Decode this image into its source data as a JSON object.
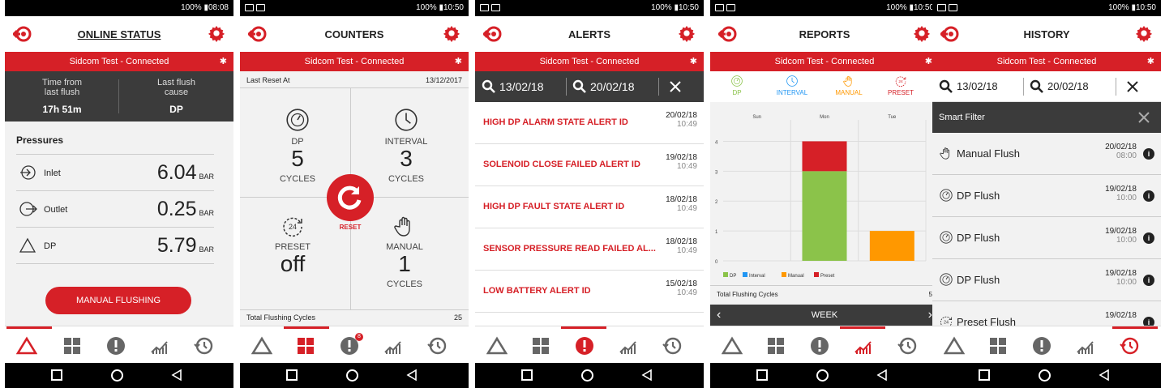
{
  "status_bar": {
    "p1": "100% ▮08:08",
    "p2": "100% ▮10:50",
    "p3": "100% ▮10:50",
    "p4": "100% ▮10:50",
    "p5": "100% ▮10:50"
  },
  "connection": "Sidcom Test - Connected",
  "colors": {
    "brand_red": "#d62027",
    "dark": "#3b3b3b",
    "dp_green": "#8bc34a",
    "interval_blue": "#2196f3",
    "manual_orange": "#ff9800",
    "preset_red": "#d62027"
  },
  "online_status": {
    "title": "ONLINE STATUS",
    "time_label": "Time from last flush",
    "time_value": "17h 51m",
    "cause_label": "Last flush cause",
    "cause_value": "DP",
    "pressures_title": "Pressures",
    "rows": [
      {
        "label": "Inlet",
        "value": "6.04",
        "unit": "BAR"
      },
      {
        "label": "Outlet",
        "value": "0.25",
        "unit": "BAR"
      },
      {
        "label": "DP",
        "value": "5.79",
        "unit": "BAR"
      }
    ],
    "button": "MANUAL FLUSHING"
  },
  "counters": {
    "title": "COUNTERS",
    "last_reset_label": "Last Reset At",
    "last_reset_date": "13/12/2017",
    "dp_label": "DP",
    "dp_value": "5",
    "interval_label": "INTERVAL",
    "interval_value": "3",
    "preset_label": "PRESET",
    "preset_value": "off",
    "manual_label": "MANUAL",
    "manual_value": "1",
    "cycles": "CYCLES",
    "reset": "RESET",
    "total_label": "Total Flushing Cycles",
    "total_value": "25",
    "badge": "8"
  },
  "alerts": {
    "title": "ALERTS",
    "from": "13/02/18",
    "to": "20/02/18",
    "items": [
      {
        "text": "HIGH DP ALARM STATE ALERT ID",
        "date": "20/02/18",
        "time": "10:49"
      },
      {
        "text": "SOLENOID CLOSE FAILED ALERT ID",
        "date": "19/02/18",
        "time": "10:49"
      },
      {
        "text": "HIGH DP FAULT STATE ALERT ID",
        "date": "18/02/18",
        "time": "10:49"
      },
      {
        "text": "SENSOR PRESSURE READ FAILED AL...",
        "date": "18/02/18",
        "time": "10:49"
      },
      {
        "text": "LOW BATTERY ALERT ID",
        "date": "15/02/18",
        "time": "10:49"
      }
    ]
  },
  "reports": {
    "title": "REPORTS",
    "tabs": [
      "DP",
      "INTERVAL",
      "MANUAL",
      "PRESET"
    ],
    "total_label": "Total Flushing Cycles",
    "total_value": "5",
    "period": "WEEK"
  },
  "chart_data": {
    "type": "bar",
    "stacked": true,
    "categories": [
      "Sun",
      "Mon",
      "Tue"
    ],
    "series": [
      {
        "name": "DP",
        "color": "#8bc34a",
        "values": [
          0,
          3,
          0
        ]
      },
      {
        "name": "Interval",
        "color": "#2196f3",
        "values": [
          0,
          0,
          0
        ]
      },
      {
        "name": "Manual",
        "color": "#ff9800",
        "values": [
          0,
          0,
          1
        ]
      },
      {
        "name": "Preset",
        "color": "#d62027",
        "values": [
          0,
          1,
          0
        ]
      }
    ],
    "ylim": [
      0,
      4.5
    ],
    "yticks": [
      "0",
      "1",
      "2",
      "3",
      "4"
    ],
    "legend": "bottom-left",
    "grid": true
  },
  "history": {
    "title": "HISTORY",
    "from": "13/02/18",
    "to": "20/02/18",
    "smart_filter": "Smart Filter",
    "items": [
      {
        "name": "Manual Flush",
        "date": "20/02/18",
        "time": "08:00",
        "icon": "hand-icon"
      },
      {
        "name": "DP Flush",
        "date": "19/02/18",
        "time": "10:00",
        "icon": "gauge-icon"
      },
      {
        "name": "DP Flush",
        "date": "19/02/18",
        "time": "10:00",
        "icon": "gauge-icon"
      },
      {
        "name": "DP Flush",
        "date": "19/02/18",
        "time": "10:00",
        "icon": "gauge-icon"
      },
      {
        "name": "Preset Flush",
        "date": "19/02/18",
        "time": "",
        "icon": "preset-timer-icon"
      }
    ]
  }
}
